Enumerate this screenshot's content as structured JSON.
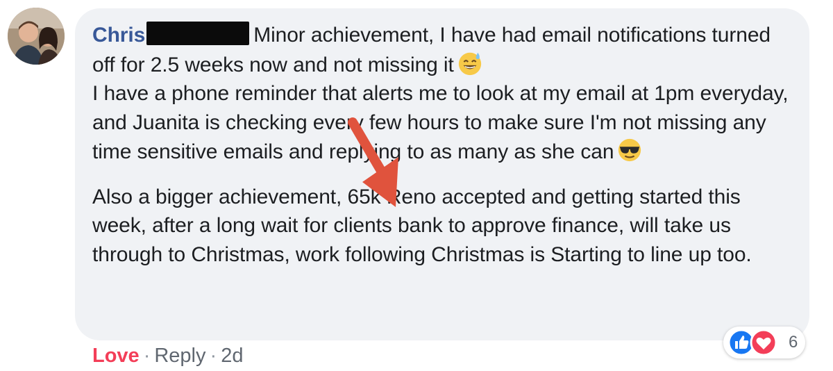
{
  "comment": {
    "author": "Chris",
    "paragraphs": [
      {
        "part1": "Minor achievement, I have had email notifications turned off for 2.5 weeks now and not missing it",
        "emoji1": "sweat-smile-emoji",
        "part2": "I have a phone reminder that alerts me to look at my email at 1pm everyday, and Juanita is checking every few hours to make sure I'm not missing any time sensitive emails and replying to as many as she can",
        "emoji2": "sunglasses-emoji"
      },
      {
        "text": "Also a bigger achievement, 65k Reno accepted and getting started this week, after a long wait for clients bank to approve finance, will take us through to Christmas, work following Christmas is Starting to line up too."
      }
    ]
  },
  "actions": {
    "love": "Love",
    "separator": "·",
    "reply": "Reply",
    "time": "2d"
  },
  "reactions": {
    "icons": [
      "like-icon",
      "love-icon"
    ],
    "count": "6"
  },
  "colors": {
    "author": "#385898",
    "love": "#f33e58",
    "bubble": "#f0f2f5",
    "like_blue": "#1877f2",
    "arrow": "#e0533d"
  }
}
